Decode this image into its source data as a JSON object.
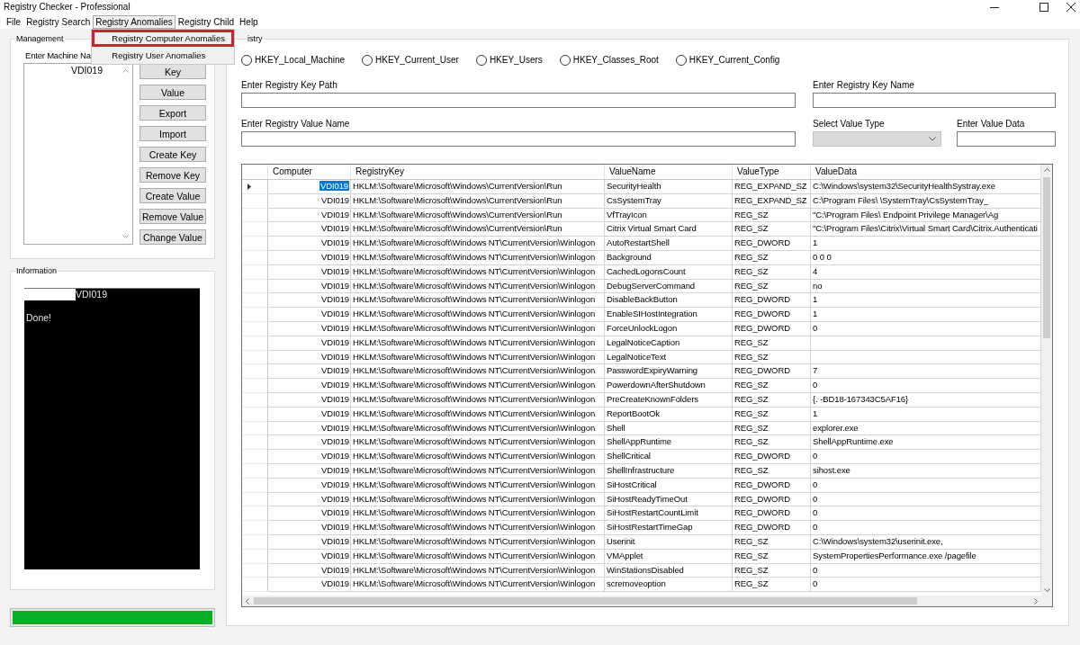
{
  "window": {
    "title": "Registry Checker - Professional"
  },
  "menu_bar": [
    {
      "label": "File",
      "expanded": false
    },
    {
      "label": "Registry Search",
      "expanded": false
    },
    {
      "label": "Registry Anomalies",
      "expanded": true,
      "items": [
        {
          "label": "Registry Computer Anomalies",
          "selected": true
        },
        {
          "label": "Registry User Anomalies",
          "selected": false
        }
      ]
    },
    {
      "label": "Registry Child",
      "expanded": false
    },
    {
      "label": "Help",
      "expanded": false
    }
  ],
  "management": {
    "title": "Management",
    "machine_label": "Enter Machine Na",
    "machines": [
      "VDI019"
    ],
    "buttons": [
      "Key",
      "Value",
      "Export",
      "Import",
      "Create Key",
      "Remove Key",
      "Create Value",
      "Remove Value",
      "Change Value"
    ]
  },
  "information": {
    "title": "Information",
    "log": [
      {
        "text": "VDI019",
        "redacted": true
      },
      {
        "text": "Done!",
        "redacted": false
      }
    ]
  },
  "progress": {
    "level": 1
  },
  "registry": {
    "title": "istry",
    "hives": [
      {
        "label": "HKEY_Local_Machine",
        "selected": false
      },
      {
        "label": "HKEY_Current_User",
        "selected": false
      },
      {
        "label": "HKEY_Users",
        "selected": false
      },
      {
        "label": "HKEY_Classes_Root",
        "selected": false
      },
      {
        "label": "HKEY_Current_Config",
        "selected": false
      }
    ],
    "fields": [
      {
        "kind": "text",
        "label": "Enter Registry Key Path",
        "disabled": false
      },
      {
        "kind": "text",
        "label": "Enter Registry Key Name",
        "disabled": false
      },
      {
        "kind": "text",
        "label": "Enter Registry Value Name",
        "disabled": false
      },
      {
        "kind": "dropdown",
        "label": "Select Value Type",
        "disabled": true
      },
      {
        "kind": "text",
        "label": "Enter Value Data",
        "disabled": false
      }
    ],
    "table": {
      "columns": [
        "Computer",
        "RegistryKey",
        "ValueName",
        "ValueType",
        "ValueData"
      ],
      "rows": [
        {
          "selected": true,
          "computer": "VDI019",
          "registry_key": "HKLM:\\Software\\Microsoft\\Windows\\CurrentVersion\\Run",
          "value_name": "SecurityHealth",
          "value_type": "REG_EXPAND_SZ",
          "value_data": "C:\\Windows\\system32\\SecurityHealthSystray.exe"
        },
        {
          "selected": false,
          "computer": "VDI019",
          "registry_key": "HKLM:\\Software\\Microsoft\\Windows\\CurrentVersion\\Run",
          "value_name": "CsSystemTray",
          "value_type": "REG_EXPAND_SZ",
          "value_data": "C:\\Program Files\\ \\SystemTray\\CsSystemTray_"
        },
        {
          "selected": false,
          "computer": "VDI019",
          "registry_key": "HKLM:\\Software\\Microsoft\\Windows\\CurrentVersion\\Run",
          "value_name": "VfTrayIcon",
          "value_type": "REG_SZ",
          "value_data": "\"C:\\Program Files\\ Endpoint Privilege Manager\\Ag"
        },
        {
          "selected": false,
          "computer": "VDI019",
          "registry_key": "HKLM:\\Software\\Microsoft\\Windows\\CurrentVersion\\Run",
          "value_name": "Citrix Virtual Smart Card",
          "value_type": "REG_SZ",
          "value_data": "\"C:\\Program Files\\Citrix\\Virtual Smart Card\\Citrix.Authenticati"
        },
        {
          "selected": false,
          "computer": "VDI019",
          "registry_key": "HKLM:\\Software\\Microsoft\\Windows NT\\CurrentVersion\\Winlogon",
          "value_name": "AutoRestartShell",
          "value_type": "REG_DWORD",
          "value_data": "1"
        },
        {
          "selected": false,
          "computer": "VDI019",
          "registry_key": "HKLM:\\Software\\Microsoft\\Windows NT\\CurrentVersion\\Winlogon",
          "value_name": "Background",
          "value_type": "REG_SZ",
          "value_data": "0 0 0"
        },
        {
          "selected": false,
          "computer": "VDI019",
          "registry_key": "HKLM:\\Software\\Microsoft\\Windows NT\\CurrentVersion\\Winlogon",
          "value_name": "CachedLogonsCount",
          "value_type": "REG_SZ",
          "value_data": "4"
        },
        {
          "selected": false,
          "computer": "VDI019",
          "registry_key": "HKLM:\\Software\\Microsoft\\Windows NT\\CurrentVersion\\Winlogon",
          "value_name": "DebugServerCommand",
          "value_type": "REG_SZ",
          "value_data": "no"
        },
        {
          "selected": false,
          "computer": "VDI019",
          "registry_key": "HKLM:\\Software\\Microsoft\\Windows NT\\CurrentVersion\\Winlogon",
          "value_name": "DisableBackButton",
          "value_type": "REG_DWORD",
          "value_data": "1"
        },
        {
          "selected": false,
          "computer": "VDI019",
          "registry_key": "HKLM:\\Software\\Microsoft\\Windows NT\\CurrentVersion\\Winlogon",
          "value_name": "EnableSIHostIntegration",
          "value_type": "REG_DWORD",
          "value_data": "1"
        },
        {
          "selected": false,
          "computer": "VDI019",
          "registry_key": "HKLM:\\Software\\Microsoft\\Windows NT\\CurrentVersion\\Winlogon",
          "value_name": "ForceUnlockLogon",
          "value_type": "REG_DWORD",
          "value_data": "0"
        },
        {
          "selected": false,
          "computer": "VDI019",
          "registry_key": "HKLM:\\Software\\Microsoft\\Windows NT\\CurrentVersion\\Winlogon",
          "value_name": "LegalNoticeCaption",
          "value_type": "REG_SZ"
        },
        {
          "selected": false,
          "computer": "VDI019",
          "registry_key": "HKLM:\\Software\\Microsoft\\Windows NT\\CurrentVersion\\Winlogon",
          "value_name": "LegalNoticeText",
          "value_type": "REG_SZ"
        },
        {
          "selected": false,
          "computer": "VDI019",
          "registry_key": "HKLM:\\Software\\Microsoft\\Windows NT\\CurrentVersion\\Winlogon",
          "value_name": "PasswordExpiryWarning",
          "value_type": "REG_DWORD",
          "value_data": "7"
        },
        {
          "selected": false,
          "computer": "VDI019",
          "registry_key": "HKLM:\\Software\\Microsoft\\Windows NT\\CurrentVersion\\Winlogon",
          "value_name": "PowerdownAfterShutdown",
          "value_type": "REG_SZ",
          "value_data": "0"
        },
        {
          "selected": false,
          "computer": "VDI019",
          "registry_key": "HKLM:\\Software\\Microsoft\\Windows NT\\CurrentVersion\\Winlogon",
          "value_name": "PreCreateKnownFolders",
          "value_type": "REG_SZ",
          "value_data": "{. -BD18-167343C5AF16}"
        },
        {
          "selected": false,
          "computer": "VDI019",
          "registry_key": "HKLM:\\Software\\Microsoft\\Windows NT\\CurrentVersion\\Winlogon",
          "value_name": "ReportBootOk",
          "value_type": "REG_SZ",
          "value_data": "1"
        },
        {
          "selected": false,
          "computer": "VDI019",
          "registry_key": "HKLM:\\Software\\Microsoft\\Windows NT\\CurrentVersion\\Winlogon",
          "value_name": "Shell",
          "value_type": "REG_SZ",
          "value_data": "explorer.exe"
        },
        {
          "selected": false,
          "computer": "VDI019",
          "registry_key": "HKLM:\\Software\\Microsoft\\Windows NT\\CurrentVersion\\Winlogon",
          "value_name": "ShellAppRuntime",
          "value_type": "REG_SZ",
          "value_data": "ShellAppRuntime.exe"
        },
        {
          "selected": false,
          "computer": "VDI019",
          "registry_key": "HKLM:\\Software\\Microsoft\\Windows NT\\CurrentVersion\\Winlogon",
          "value_name": "ShellCritical",
          "value_type": "REG_DWORD",
          "value_data": "0"
        },
        {
          "selected": false,
          "computer": "VDI019",
          "registry_key": "HKLM:\\Software\\Microsoft\\Windows NT\\CurrentVersion\\Winlogon",
          "value_name": "ShellInfrastructure",
          "value_type": "REG_SZ",
          "value_data": "sihost.exe"
        },
        {
          "selected": false,
          "computer": "VDI019",
          "registry_key": "HKLM:\\Software\\Microsoft\\Windows NT\\CurrentVersion\\Winlogon",
          "value_name": "SiHostCritical",
          "value_type": "REG_DWORD",
          "value_data": "0"
        },
        {
          "selected": false,
          "computer": "VDI019",
          "registry_key": "HKLM:\\Software\\Microsoft\\Windows NT\\CurrentVersion\\Winlogon",
          "value_name": "SiHostReadyTimeOut",
          "value_type": "REG_DWORD",
          "value_data": "0"
        },
        {
          "selected": false,
          "computer": "VDI019",
          "registry_key": "HKLM:\\Software\\Microsoft\\Windows NT\\CurrentVersion\\Winlogon",
          "value_name": "SiHostRestartCountLimit",
          "value_type": "REG_DWORD",
          "value_data": "0"
        },
        {
          "selected": false,
          "computer": "VDI019",
          "registry_key": "HKLM:\\Software\\Microsoft\\Windows NT\\CurrentVersion\\Winlogon",
          "value_name": "SiHostRestartTimeGap",
          "value_type": "REG_DWORD",
          "value_data": "0"
        },
        {
          "selected": false,
          "computer": "VDI019",
          "registry_key": "HKLM:\\Software\\Microsoft\\Windows NT\\CurrentVersion\\Winlogon",
          "value_name": "Userinit",
          "value_type": "REG_SZ",
          "value_data": "C:\\Windows\\system32\\userinit.exe,"
        },
        {
          "selected": false,
          "computer": "VDI019",
          "registry_key": "HKLM:\\Software\\Microsoft\\Windows NT\\CurrentVersion\\Winlogon",
          "value_name": "VMApplet",
          "value_type": "REG_SZ",
          "value_data": "SystemPropertiesPerformance.exe /pagefile"
        },
        {
          "selected": false,
          "computer": "VDI019",
          "registry_key": "HKLM:\\Software\\Microsoft\\Windows NT\\CurrentVersion\\Winlogon",
          "value_name": "WinStationsDisabled",
          "value_type": "REG_SZ",
          "value_data": "0"
        },
        {
          "selected": false,
          "computer": "VDI019",
          "registry_key": "HKLM:\\Software\\Microsoft\\Windows NT\\CurrentVersion\\Winlogon",
          "value_name": "scremoveoption",
          "value_type": "REG_SZ",
          "value_data": "0"
        }
      ]
    }
  }
}
